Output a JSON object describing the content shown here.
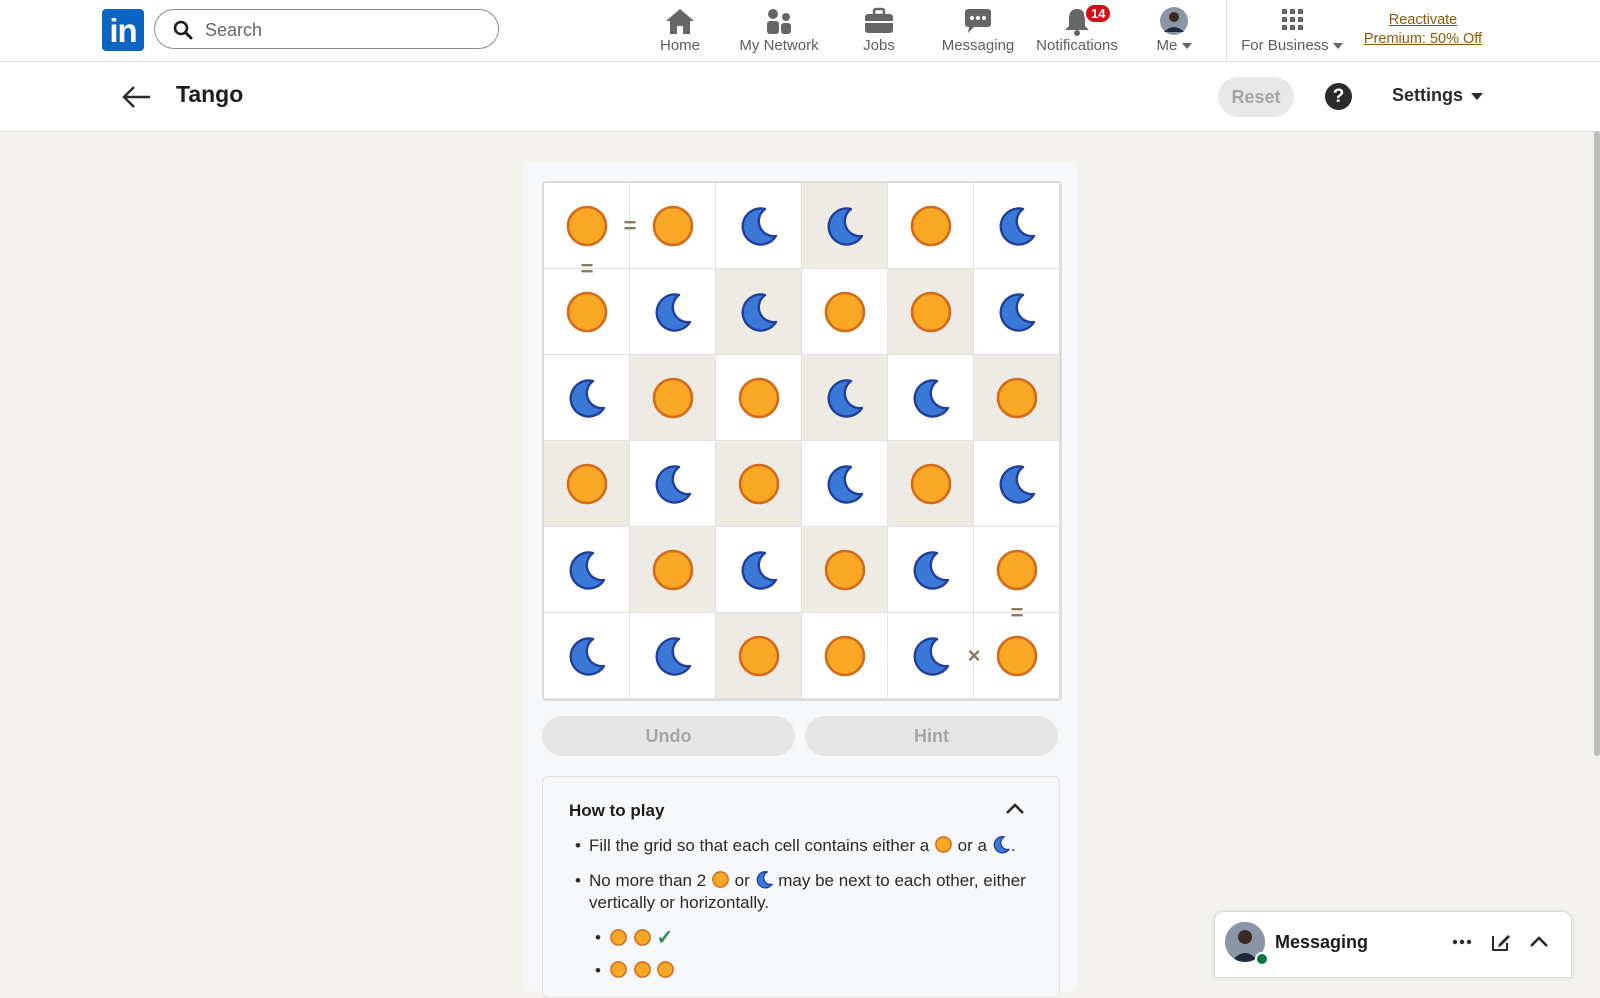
{
  "nav": {
    "logo_text": "in",
    "search_placeholder": "Search",
    "items": [
      {
        "label": "Home",
        "icon": "home-icon"
      },
      {
        "label": "My Network",
        "icon": "network-icon"
      },
      {
        "label": "Jobs",
        "icon": "briefcase-icon"
      },
      {
        "label": "Messaging",
        "icon": "chat-icon"
      },
      {
        "label": "Notifications",
        "icon": "bell-icon",
        "badge": "14"
      },
      {
        "label": "Me",
        "icon": "avatar"
      },
      {
        "label": "For Business",
        "icon": "grid-icon"
      }
    ],
    "premium_line1": "Reactivate",
    "premium_line2": "Premium: 50% Off"
  },
  "header": {
    "title": "Tango",
    "reset_label": "Reset",
    "help_label": "?",
    "settings_label": "Settings"
  },
  "game": {
    "board": [
      [
        "sun",
        "sun",
        "moon",
        "moon",
        "sun",
        "moon"
      ],
      [
        "sun",
        "moon",
        "moon",
        "sun",
        "sun",
        "moon"
      ],
      [
        "moon",
        "sun",
        "sun",
        "moon",
        "moon",
        "sun"
      ],
      [
        "sun",
        "moon",
        "sun",
        "moon",
        "sun",
        "moon"
      ],
      [
        "moon",
        "sun",
        "moon",
        "sun",
        "moon",
        "sun"
      ],
      [
        "moon",
        "moon",
        "sun",
        "sun",
        "moon",
        "sun"
      ]
    ],
    "locked": [
      [
        false,
        false,
        false,
        true,
        false,
        false
      ],
      [
        false,
        false,
        true,
        false,
        true,
        false
      ],
      [
        false,
        true,
        false,
        true,
        false,
        true
      ],
      [
        true,
        false,
        true,
        false,
        true,
        false
      ],
      [
        false,
        true,
        false,
        true,
        false,
        false
      ],
      [
        false,
        false,
        true,
        false,
        false,
        false
      ]
    ],
    "constraints": [
      {
        "between": [
          [
            0,
            0
          ],
          [
            0,
            1
          ]
        ],
        "symbol": "="
      },
      {
        "between": [
          [
            0,
            0
          ],
          [
            1,
            0
          ]
        ],
        "symbol": "="
      },
      {
        "between": [
          [
            4,
            5
          ],
          [
            5,
            5
          ]
        ],
        "symbol": "="
      },
      {
        "between": [
          [
            5,
            4
          ],
          [
            5,
            5
          ]
        ],
        "symbol": "×"
      }
    ],
    "undo_label": "Undo",
    "hint_label": "Hint",
    "colors": {
      "sun": "#f9a825",
      "sun_stroke": "#d46a1a",
      "moon": "#3b78d8",
      "moon_stroke": "#1f3f9a"
    }
  },
  "howto": {
    "title": "How to play",
    "rule1_a": "Fill the grid so that each cell contains either a",
    "rule1_b": "or a",
    "rule1_c": ".",
    "rule2_a": "No more than 2",
    "rule2_b": "or",
    "rule2_c": "may be next to each other, either vertically or horizontally."
  },
  "messaging": {
    "title": "Messaging"
  }
}
